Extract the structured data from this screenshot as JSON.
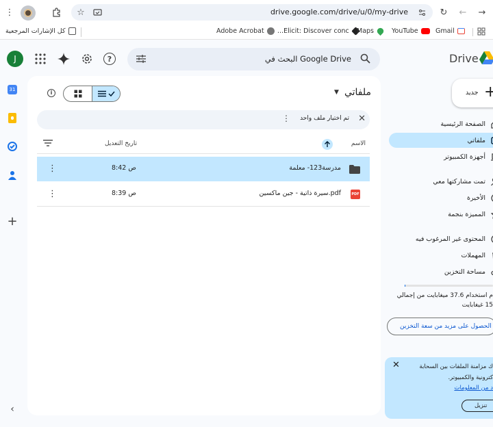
{
  "browser": {
    "url": "drive.google.com/drive/u/0/my-drive",
    "bookmarks": [
      {
        "label": "كل الإشارات المرجعية",
        "icon": "folder-icon"
      },
      {
        "label": "Adobe Acrobat",
        "icon": "acrobat-icon",
        "color": "#777777"
      },
      {
        "label": "Elicit: Discover conc...",
        "icon": "elicit-icon",
        "color": "#222222"
      },
      {
        "label": "Maps",
        "icon": "maps-icon",
        "color": "#34a853"
      },
      {
        "label": "YouTube",
        "icon": "youtube-icon",
        "color": "#ff0000"
      },
      {
        "label": "Gmail",
        "icon": "gmail-icon",
        "color": "#ea4335"
      }
    ]
  },
  "header": {
    "app_name": "Drive",
    "search_placeholder": "البحث في Google Drive",
    "avatar_letter": "J",
    "avatar_color": "#188038"
  },
  "nav": {
    "new_label": "جديد",
    "items": [
      {
        "label": "الصفحة الرئيسية",
        "icon": "home-icon"
      },
      {
        "label": "ملفاتي",
        "icon": "my-drive-icon",
        "active": true
      },
      {
        "label": "أجهزة الكمبيوتر",
        "icon": "computer-icon"
      },
      {
        "label": "تمت مشاركتها معي",
        "icon": "shared-icon"
      },
      {
        "label": "الأخيرة",
        "icon": "clock-icon"
      },
      {
        "label": "المميزة بنجمة",
        "icon": "star-icon"
      },
      {
        "label": "المحتوى غير المرغوب فيه",
        "icon": "spam-icon"
      },
      {
        "label": "المهملات",
        "icon": "trash-icon"
      },
      {
        "label": "مساحة التخزين",
        "icon": "cloud-icon"
      }
    ],
    "storage_text_1": "م استخدام 37.6 ميغابايت من إجمالي",
    "storage_text_2": "15 غيغابايت",
    "storage_button": "الحصول على مزيد من سعة التخزين"
  },
  "promo": {
    "line1": "ك مزامنة الملفات بين السحابة",
    "line2": "كترونية والكمبيوتر.",
    "link": "د من المعلومات",
    "button": "تنزيل"
  },
  "main": {
    "title": "ملفاتي",
    "selection_text": "تم اختيار ملف واحد",
    "col_name": "الاسم",
    "col_modified": "تاريخ التعديل",
    "rows": [
      {
        "name": "مدرسة123- معلمة",
        "type": "folder",
        "modified": "8:42 ص",
        "selected": true
      },
      {
        "name": "سيرة ذاتية - جين ماكسين.pdf",
        "type": "pdf",
        "modified": "8:39 ص",
        "selected": false
      }
    ]
  }
}
